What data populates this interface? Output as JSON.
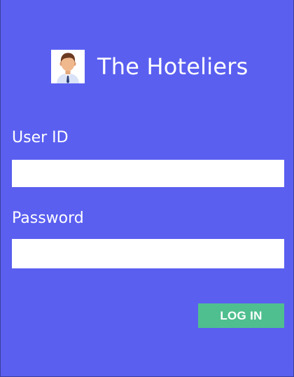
{
  "app": {
    "title": "The Hoteliers",
    "logo_icon": "user-avatar-icon"
  },
  "form": {
    "user_id_label": "User ID",
    "user_id_value": "",
    "password_label": "Password",
    "password_value": "",
    "login_label": "LOG IN"
  },
  "colors": {
    "background": "#5a5ff0",
    "button": "#4fbf8f",
    "text": "#ffffff",
    "input": "#ffffff"
  }
}
